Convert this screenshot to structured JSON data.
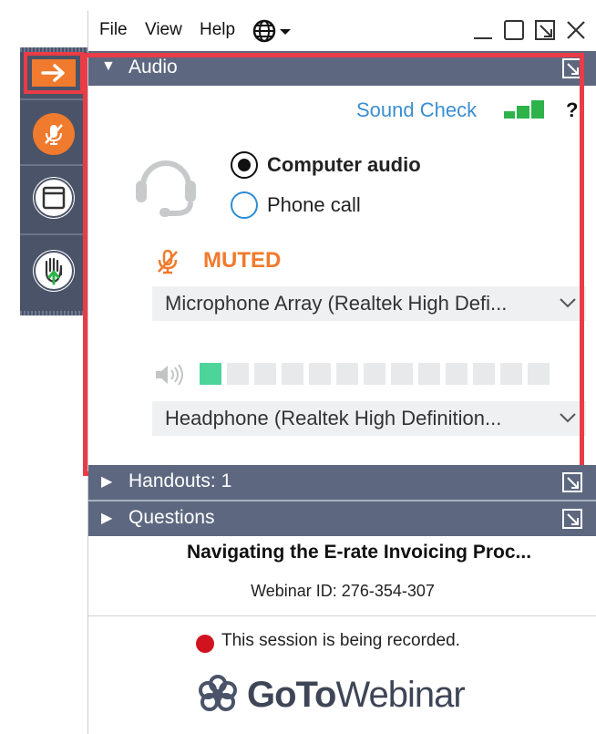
{
  "menu": {
    "file": "File",
    "view": "View",
    "help": "Help"
  },
  "audio": {
    "header": "Audio",
    "sound_check": "Sound Check",
    "option_computer": "Computer audio",
    "option_phone": "Phone call",
    "selected": "Computer audio",
    "mute_status": "MUTED",
    "microphone_device": "Microphone Array (Realtek High Defi...",
    "speaker_device": "Headphone (Realtek High Definition...",
    "speaker_level": 0.07,
    "colors": {
      "muted": "#f07a2d",
      "signal": "#2db34a",
      "level_active": "#4cd49b",
      "link": "#3b8ed0"
    }
  },
  "handouts": {
    "header": "Handouts: 1"
  },
  "questions": {
    "header": "Questions"
  },
  "session": {
    "title": "Navigating the E-rate Invoicing Proc...",
    "webinar_id": "Webinar ID: 276-354-307",
    "recording_notice": "This session is being recorded."
  },
  "brand": {
    "goto": "GoTo",
    "webinar": "Webinar"
  },
  "toolbar": {
    "icons": [
      "grab-tab-arrow-icon",
      "microphone-muted-icon",
      "screen-icon",
      "raise-hand-icon"
    ]
  }
}
